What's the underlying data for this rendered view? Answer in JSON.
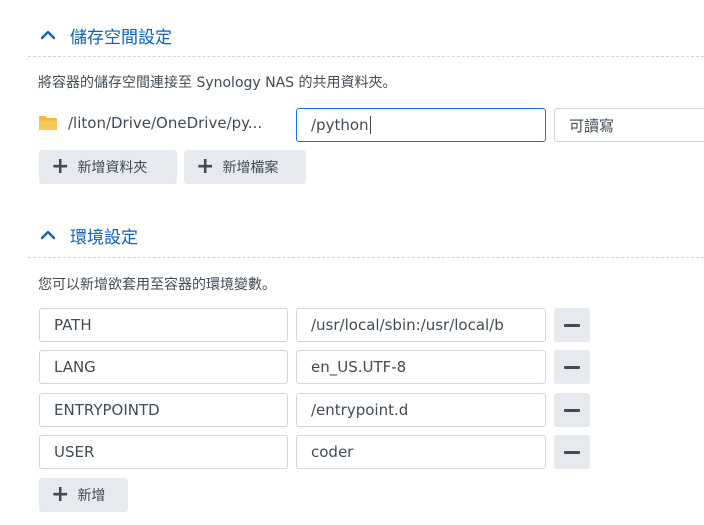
{
  "storage": {
    "title": "儲存空間設定",
    "description": "將容器的儲存空間連接至 Synology NAS 的共用資料夾。",
    "mount": {
      "host_path": "/liton/Drive/OneDrive/py...",
      "container_path": "/python",
      "permission": "可讀寫"
    },
    "add_folder_label": "新增資料夾",
    "add_file_label": "新增檔案"
  },
  "env": {
    "title": "環境設定",
    "description": "您可以新增欲套用至容器的環境變數。",
    "variables": [
      {
        "key": "PATH",
        "value": "/usr/local/sbin:/usr/local/b"
      },
      {
        "key": "LANG",
        "value": "en_US.UTF-8"
      },
      {
        "key": "ENTRYPOINTD",
        "value": "/entrypoint.d"
      },
      {
        "key": "USER",
        "value": "coder"
      }
    ],
    "add_label": "新增"
  },
  "colors": {
    "accent": "#0d62b8",
    "folder": "#f3b73a",
    "button_bg": "#e6eaef",
    "active_border": "#1b73d3"
  }
}
